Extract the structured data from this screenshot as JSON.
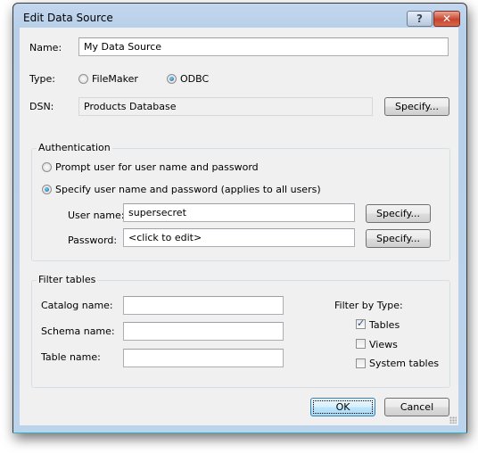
{
  "window": {
    "title": "Edit Data Source",
    "help_glyph": "?",
    "close_glyph": "✕"
  },
  "general": {
    "name_label": "Name:",
    "name_value": "My Data Source",
    "type_label": "Type:",
    "type_options": [
      {
        "label": "FileMaker",
        "selected": false
      },
      {
        "label": "ODBC",
        "selected": true
      }
    ],
    "dsn_label": "DSN:",
    "dsn_value": "Products Database",
    "dsn_specify": "Specify..."
  },
  "authentication": {
    "title": "Authentication",
    "options": [
      {
        "label": "Prompt user for user name and password",
        "selected": false
      },
      {
        "label": "Specify user name and password (applies to all users)",
        "selected": true
      }
    ],
    "username_label": "User name:",
    "username_value": "supersecret",
    "username_specify": "Specify...",
    "password_label": "Password:",
    "password_value": "<click to edit>",
    "password_specify": "Specify..."
  },
  "filter": {
    "title": "Filter tables",
    "catalog_label": "Catalog name:",
    "catalog_value": "",
    "schema_label": "Schema name:",
    "schema_value": "",
    "table_label": "Table name:",
    "table_value": "",
    "by_type_label": "Filter by Type:",
    "types": [
      {
        "label": "Tables",
        "checked": true
      },
      {
        "label": "Views",
        "checked": false
      },
      {
        "label": "System tables",
        "checked": false
      }
    ]
  },
  "footer": {
    "ok": "OK",
    "cancel": "Cancel"
  }
}
